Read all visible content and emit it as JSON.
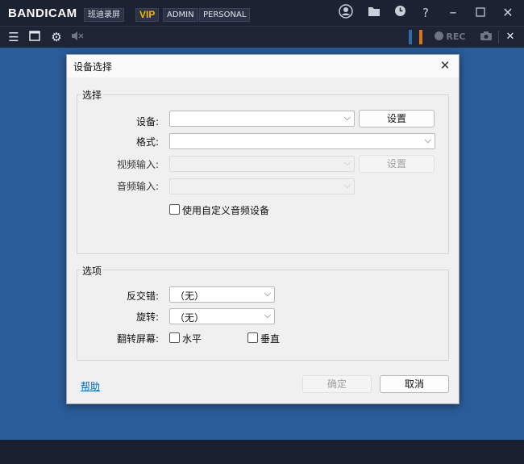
{
  "app": {
    "logo": "BANDICAM",
    "title_cn": "班迪录屏",
    "vip": "VIP",
    "admin": "ADMIN",
    "personal": "PERSONAL",
    "rec": "REC"
  },
  "dialog": {
    "title": "设备选择",
    "select_group": {
      "label": "选择",
      "device_label": "设备:",
      "device_value": "",
      "device_settings_button": "设置",
      "format_label": "格式:",
      "format_value": "",
      "video_input_label": "视频输入:",
      "video_input_value": "",
      "video_settings_button": "设置",
      "audio_input_label": "音频输入:",
      "audio_input_value": "",
      "custom_audio_checkbox": "使用自定义音频设备"
    },
    "options_group": {
      "label": "选项",
      "deinterlace_label": "反交错:",
      "deinterlace_value": "（无）",
      "rotate_label": "旋转:",
      "rotate_value": "（无）",
      "flip_label": "翻转屏幕:",
      "flip_horizontal": "水平",
      "flip_vertical": "垂直"
    },
    "help_link": "帮助",
    "ok_button": "确定",
    "cancel_button": "取消"
  }
}
